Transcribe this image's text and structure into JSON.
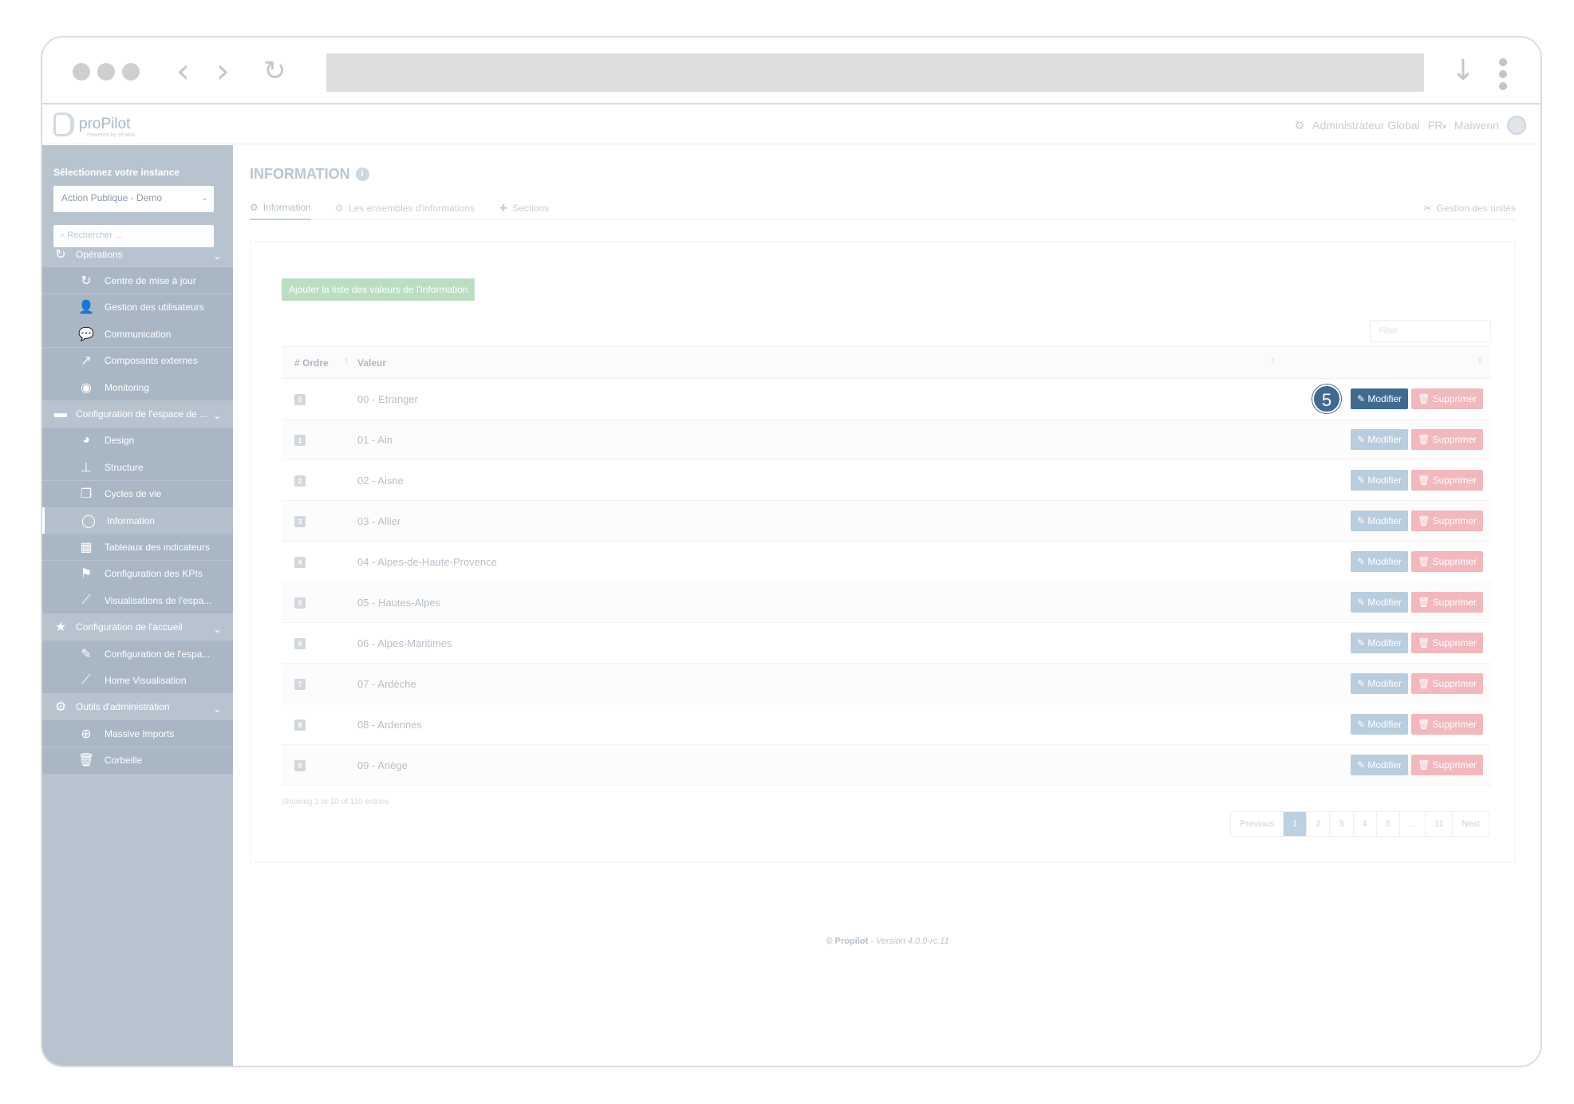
{
  "app": {
    "brand": "proPilot",
    "brand_sub": "Powered by eFakta",
    "admin_label": "Administrateur Global",
    "language": "FR",
    "user": "Maiwenn"
  },
  "sidebar": {
    "instance_title": "Sélectionnez votre instance",
    "instance_value": "Action Publique - Demo",
    "search_placeholder": "Rechercher ...",
    "items": [
      {
        "label": "Opérations",
        "type": "section",
        "icon": "refresh-icon"
      },
      {
        "label": "Centre de mise à jour",
        "type": "sub",
        "icon": "refresh-icon"
      },
      {
        "label": "Gestion des utilisateurs",
        "type": "sub",
        "icon": "user-icon"
      },
      {
        "label": "Communication",
        "type": "sub",
        "icon": "chat-icon"
      },
      {
        "label": "Composants externes",
        "type": "sub",
        "icon": "external-link-icon"
      },
      {
        "label": "Monitoring",
        "type": "sub",
        "icon": "eye-icon"
      },
      {
        "label": "Configuration de l'espace de ...",
        "type": "section",
        "icon": "folder-icon"
      },
      {
        "label": "Design",
        "type": "sub",
        "icon": "palette-icon"
      },
      {
        "label": "Structure",
        "type": "sub",
        "icon": "sitemap-icon"
      },
      {
        "label": "Cycles de vie",
        "type": "sub",
        "icon": "copy-icon"
      },
      {
        "label": "Information",
        "type": "sub",
        "icon": "comment-icon",
        "active": true
      },
      {
        "label": "Tableaux des indicateurs",
        "type": "sub",
        "icon": "table-icon"
      },
      {
        "label": "Configuration des KPIs",
        "type": "sub",
        "icon": "flag-icon"
      },
      {
        "label": "Visualisations de l'espa...",
        "type": "sub",
        "icon": "line-chart-icon"
      },
      {
        "label": "Configuration de l'accueil",
        "type": "section",
        "icon": "star-icon"
      },
      {
        "label": "Configuration de l'espa...",
        "type": "sub",
        "icon": "edit-icon"
      },
      {
        "label": "Home Visualisation",
        "type": "sub",
        "icon": "line-chart-icon"
      },
      {
        "label": "Outils d'administration",
        "type": "section",
        "icon": "gear-icon"
      },
      {
        "label": "Massive Imports",
        "type": "sub",
        "icon": "download-circle-icon"
      },
      {
        "label": "Corbeille",
        "type": "sub",
        "icon": "trash-icon"
      }
    ]
  },
  "page": {
    "title": "INFORMATION",
    "tabs": [
      {
        "label": "Information",
        "active": true
      },
      {
        "label": "Les ensembles d'informations"
      },
      {
        "label": "Sections"
      }
    ],
    "units_link": "Gestion des unités",
    "add_button": "Ajouter la liste des valeurs de l'information",
    "filter_placeholder": "Filter"
  },
  "table": {
    "columns": [
      "# Ordre",
      "Valeur"
    ],
    "rows": [
      {
        "order": "0",
        "value": "00 - Etranger"
      },
      {
        "order": "1",
        "value": "01 - Ain"
      },
      {
        "order": "2",
        "value": "02 - Aisne"
      },
      {
        "order": "3",
        "value": "03 - Allier"
      },
      {
        "order": "4",
        "value": "04 - Alpes-de-Haute-Provence"
      },
      {
        "order": "5",
        "value": "05 - Hautes-Alpes"
      },
      {
        "order": "6",
        "value": "06 - Alpes-Maritimes"
      },
      {
        "order": "7",
        "value": "07 - Ardèche"
      },
      {
        "order": "8",
        "value": "08 - Ardennes"
      },
      {
        "order": "9",
        "value": "09 - Ariège"
      }
    ],
    "edit_label": "Modifier",
    "delete_label": "Supprimer",
    "step_badge": "5",
    "showing": "Showing 1 to 10 of 110 entries",
    "pagination": [
      "Previous",
      "1",
      "2",
      "3",
      "4",
      "5",
      "...",
      "11",
      "Next"
    ],
    "current_page": "1"
  },
  "footer": {
    "brand": "© Propilot",
    "version": " - Version 4.0.0-rc.11"
  },
  "colors": {
    "sidebar": "#b7c4d0",
    "highlight": "#3f6b91",
    "success": "#b9dfc0",
    "danger": "#f1b8be"
  }
}
